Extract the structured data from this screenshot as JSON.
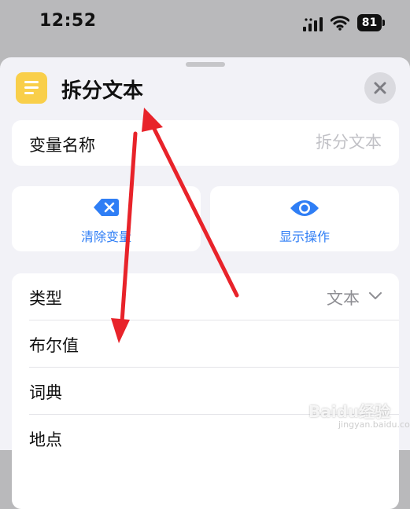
{
  "status_bar": {
    "time": "12:52",
    "battery": "81"
  },
  "sheet": {
    "title": "拆分文本",
    "action_icon": "text-lines-icon",
    "accent_color": "#f9cf4a"
  },
  "variable_field": {
    "label": "变量名称",
    "placeholder": "拆分文本",
    "value": ""
  },
  "buttons": {
    "clear": {
      "label": "清除变量",
      "icon": "clear-delete-icon"
    },
    "show": {
      "label": "显示操作",
      "icon": "eye-icon"
    }
  },
  "type_list": {
    "header": {
      "label": "类型",
      "selected": "文本"
    },
    "options": [
      "布尔值",
      "词典",
      "地点"
    ]
  },
  "colors": {
    "link_blue": "#2f7ef5",
    "annotation_red": "#e8232a"
  },
  "watermark": {
    "brand": "Baidu经验",
    "url": "jingyan.baidu.com"
  }
}
